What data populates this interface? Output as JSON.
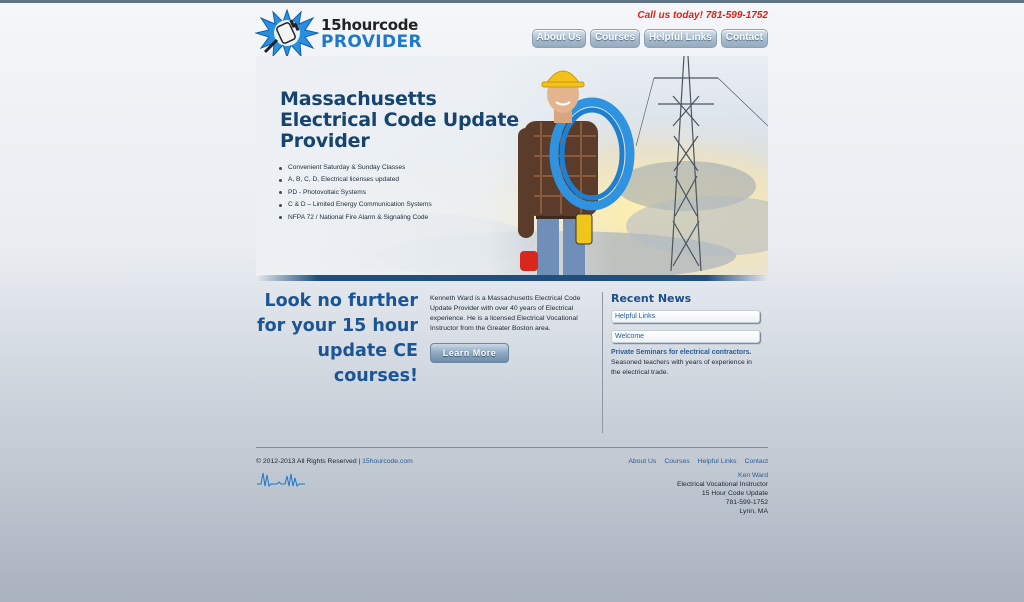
{
  "brand": {
    "logo_top": "15hourcode",
    "logo_bottom": "PROVIDER",
    "phone": "Call us today! 781-599-1752"
  },
  "nav": {
    "items": [
      {
        "label": "About Us"
      },
      {
        "label": "Courses"
      },
      {
        "label": "Helpful Links"
      },
      {
        "label": "Contact"
      }
    ]
  },
  "hero": {
    "title": "Massachusetts Electrical Code Update Provider",
    "bullets": [
      "Convenient Saturday & Sunday Classes",
      "A, B, C, D,  Electrical licenses updated",
      "PD -  Photovoltaic Systems",
      "C & D – Limited Energy Communication Systems",
      "NFPA 72 / National Fire Alarm & Signaling Code"
    ]
  },
  "content": {
    "tagline": "Look no further for your 15 hour update CE courses!",
    "intro": "Kenneth Ward is a Massachusetts Electrical Code Update Provider with over 40 years of Electrical experience. He is a licensed Electrical Vocational Instructor from the Greater Boston area.",
    "learn_more": "Learn More"
  },
  "news": {
    "title": "Recent News",
    "links": [
      "Helpful Links",
      "Welcome"
    ],
    "item_heading": "Private Seminars for electrical contractors.",
    "item_body": "Seasoned teachers with years of experience in the electrical trade."
  },
  "footer": {
    "copyright": "© 2012-2013 All Rights Reserved |",
    "site_link": "15hourcode.com",
    "nav": [
      "About Us",
      "Courses",
      "Helpful Links",
      "Contact"
    ],
    "contact_name": "Ken Ward",
    "contact_lines": [
      "Electrical Vocational Instructor",
      "15 Hour Code Update",
      "781-599-1752",
      "Lynn, MA"
    ]
  },
  "colors": {
    "brand_blue": "#1f79c9",
    "heading_navy": "#17446f",
    "link_blue": "#2a5d97",
    "phone_red": "#d8231b"
  }
}
